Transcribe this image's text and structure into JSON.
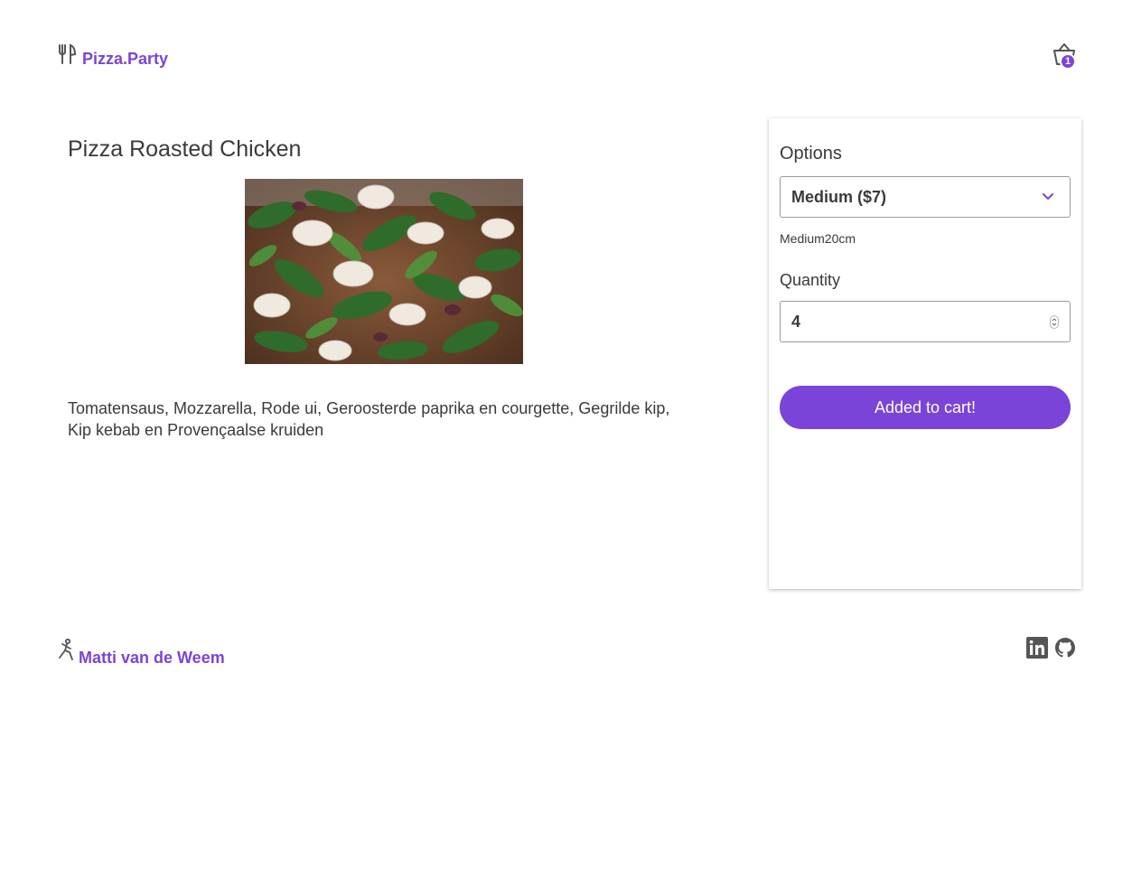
{
  "header": {
    "brand_name": "Pizza.Party",
    "cart_count": "1"
  },
  "product": {
    "title": "Pizza Roasted Chicken",
    "description": "Tomatensaus, Mozzarella, Rode ui, Geroosterde paprika en courgette, Gegrilde kip, Kip kebab en Provençaalse kruiden"
  },
  "options_panel": {
    "options_label": "Options",
    "selected_option": "Medium ($7)",
    "size_note": "Medium20cm",
    "quantity_label": "Quantity",
    "quantity_value": "4",
    "add_button_label": "Added to cart!"
  },
  "footer": {
    "author_name": "Matti van de Weem",
    "social_icons": [
      "linkedin-icon",
      "github-icon"
    ]
  },
  "colors": {
    "accent": "#7b44d8",
    "text": "#3a3a3a"
  }
}
